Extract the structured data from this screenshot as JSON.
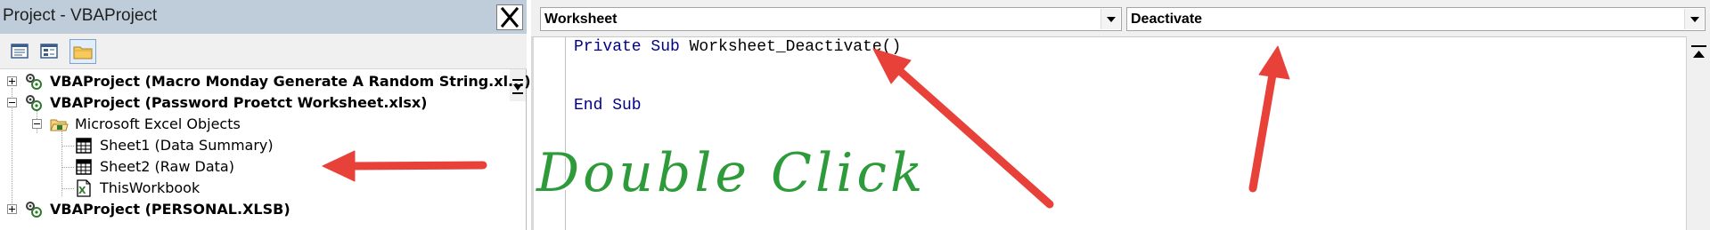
{
  "project_explorer": {
    "title": "Project - VBAProject",
    "toolbar": {
      "view_code_icon": "view-code-icon",
      "view_object_icon": "view-object-icon",
      "toggle_folders_icon": "folder-icon"
    },
    "tree": [
      {
        "label": "VBAProject (Macro Monday Generate A Random String.xl...)",
        "bold": true,
        "expander": "+"
      },
      {
        "label": "VBAProject (Password Proetct Worksheet.xlsx)",
        "bold": true,
        "expander": "-"
      },
      {
        "label": "Microsoft Excel Objects",
        "bold": false,
        "expander": "-"
      },
      {
        "label": "Sheet1 (Data Summary)",
        "bold": false
      },
      {
        "label": "Sheet2 (Raw Data)",
        "bold": false
      },
      {
        "label": "ThisWorkbook",
        "bold": false
      },
      {
        "label": "VBAProject (PERSONAL.XLSB)",
        "bold": true,
        "expander": "+"
      }
    ]
  },
  "code_window": {
    "object_dropdown": "Worksheet",
    "procedure_dropdown": "Deactivate",
    "code": {
      "line1_keyword": "Private Sub ",
      "line1_name": "Worksheet_Deactivate()",
      "line2": "End Sub"
    }
  },
  "annotation": {
    "text": "Double Click",
    "arrow_color": "#e8413a",
    "text_color": "#2e9b3a"
  }
}
